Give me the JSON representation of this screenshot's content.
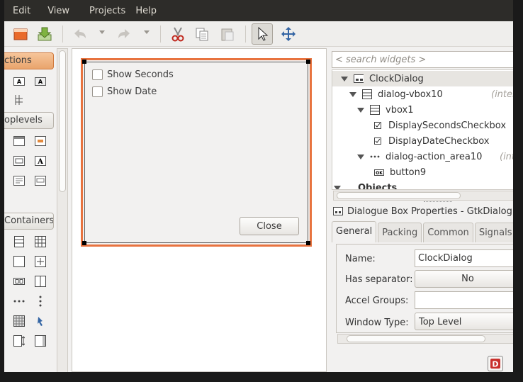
{
  "menubar": {
    "items": [
      "Edit",
      "View",
      "Projects",
      "Help"
    ]
  },
  "toolbar": {
    "icons": [
      "open-project-icon",
      "save-project-icon",
      "undo-icon",
      "redo-icon",
      "cut-icon",
      "copy-icon",
      "paste-icon",
      "select-pointer-icon",
      "drag-resize-icon"
    ]
  },
  "palette": {
    "groups": [
      {
        "label": "ctions"
      },
      {
        "label": "oplevels"
      },
      {
        "label": "Containers"
      }
    ]
  },
  "dialog": {
    "checkboxes": [
      {
        "label": "Show Seconds",
        "checked": false
      },
      {
        "label": "Show Date",
        "checked": false
      }
    ],
    "close_label": "Close"
  },
  "inspector": {
    "search_placeholder": "< search widgets >",
    "tree": [
      {
        "label": "ClockDialog",
        "internal": ""
      },
      {
        "label": "dialog-vbox10",
        "internal": "(intern"
      },
      {
        "label": "vbox1",
        "internal": ""
      },
      {
        "label": "DisplaySecondsCheckbox",
        "internal": ""
      },
      {
        "label": "DisplayDateCheckbox",
        "internal": ""
      },
      {
        "label": "dialog-action_area10",
        "internal": "(inter"
      },
      {
        "label": "button9",
        "internal": ""
      },
      {
        "label": "Objects",
        "internal": ""
      }
    ]
  },
  "properties": {
    "title": "Dialogue Box Properties - GtkDialog [Cloc",
    "tabs": [
      "General",
      "Packing",
      "Common",
      "Signals"
    ],
    "fields": {
      "name_label": "Name:",
      "name_value": "ClockDialog",
      "separator_label": "Has separator:",
      "separator_value": "No",
      "accel_label": "Accel Groups:",
      "accel_value": "",
      "window_type_label": "Window Type:",
      "window_type_value": "Top Level"
    }
  },
  "colors": {
    "selection_orange": "#e8733f",
    "menubar_bg": "#2d2c29"
  }
}
